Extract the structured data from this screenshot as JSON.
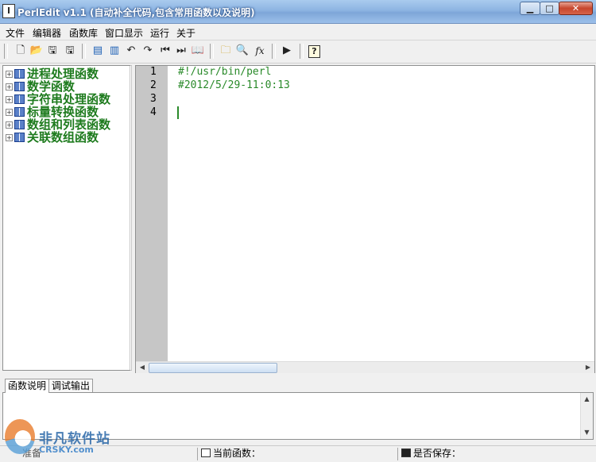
{
  "window": {
    "app_icon": "document-icon",
    "title": "PerlEdit v1.1 (自动补全代码,包含常用函数以及说明)",
    "minimize": "▁",
    "maximize": "□",
    "close": "✕"
  },
  "menu": {
    "items": [
      "文件",
      "编辑器",
      "函数库",
      "窗口显示",
      "运行",
      "关于"
    ]
  },
  "toolbar": {
    "buttons": [
      {
        "name": "new-file-icon",
        "glyph": "🗋"
      },
      {
        "name": "open-folder-icon",
        "glyph": "📂"
      },
      {
        "name": "save-icon",
        "glyph": "🖫"
      },
      {
        "name": "save-all-icon",
        "glyph": "🖫"
      },
      {
        "name": "layout-left-icon",
        "glyph": "▤"
      },
      {
        "name": "layout-split-icon",
        "glyph": "▥"
      },
      {
        "name": "undo-icon",
        "glyph": "↶"
      },
      {
        "name": "redo-icon",
        "glyph": "↷"
      },
      {
        "name": "skip-first-icon",
        "glyph": "⏮"
      },
      {
        "name": "skip-last-icon",
        "glyph": "⏭"
      },
      {
        "name": "book-icon",
        "glyph": "📖"
      },
      {
        "name": "folder-find-icon",
        "glyph": "🗀"
      },
      {
        "name": "search-icon",
        "glyph": "🔍"
      },
      {
        "name": "function-icon",
        "glyph": "fx"
      },
      {
        "name": "run-icon",
        "glyph": "▶"
      },
      {
        "name": "help-icon",
        "glyph": "?"
      }
    ]
  },
  "tree": {
    "items": [
      {
        "label": "进程处理函数"
      },
      {
        "label": "数学函数"
      },
      {
        "label": "字符串处理函数"
      },
      {
        "label": "标量转换函数"
      },
      {
        "label": "数组和列表函数"
      },
      {
        "label": "关联数组函数"
      }
    ]
  },
  "editor": {
    "line_numbers": [
      "1",
      "2",
      "3",
      "4"
    ],
    "lines": [
      "#!/usr/bin/perl",
      "#2012/5/29-11:0:13",
      "",
      ""
    ]
  },
  "bottom_tabs": [
    "函数说明",
    "调试输出"
  ],
  "status": {
    "left_text": "准备",
    "current_function_label": "当前函数：",
    "saved_label": "是否保存："
  },
  "watermark": {
    "text": "非凡软件站",
    "subtext": "CRSKY.com"
  },
  "colors": {
    "code_green": "#2a8a2a",
    "tree_green": "#1e7b1e",
    "gutter_gray": "#c6c6c6",
    "titlebar_blue": "#8db4e2"
  }
}
